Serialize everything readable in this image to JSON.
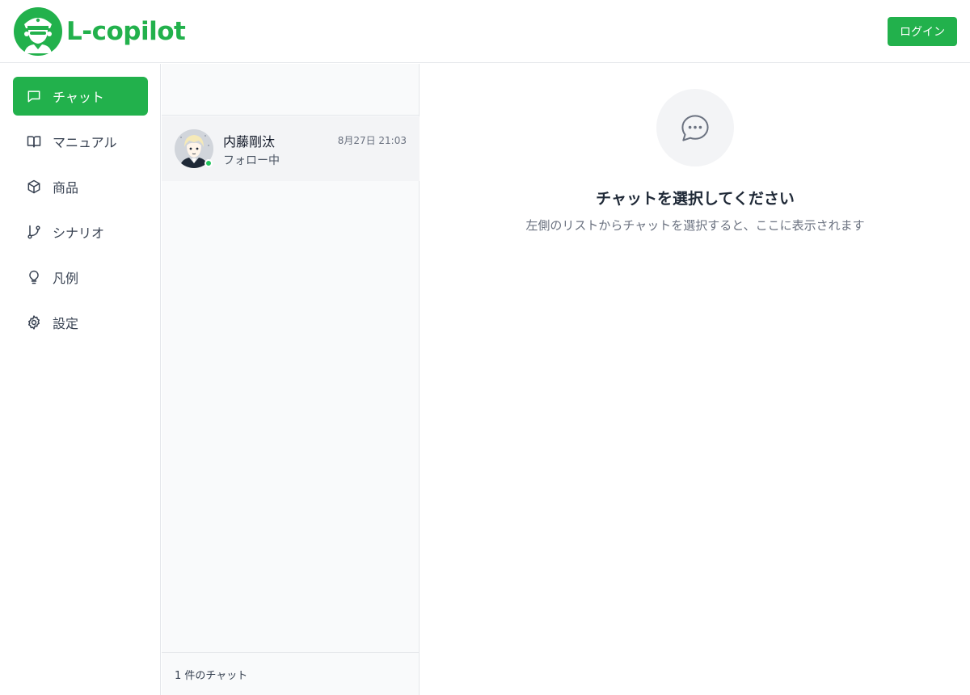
{
  "header": {
    "brand": "L-copilot",
    "login_label": "ログイン"
  },
  "colors": {
    "accent": "#22b14c",
    "online": "#22c55e"
  },
  "sidebar": {
    "items": [
      {
        "label": "チャット",
        "icon": "chat-bubble-icon",
        "active": true
      },
      {
        "label": "マニュアル",
        "icon": "book-icon",
        "active": false
      },
      {
        "label": "商品",
        "icon": "box-icon",
        "active": false
      },
      {
        "label": "シナリオ",
        "icon": "branch-icon",
        "active": false
      },
      {
        "label": "凡例",
        "icon": "lightbulb-icon",
        "active": false
      },
      {
        "label": "設定",
        "icon": "gear-icon",
        "active": false
      }
    ]
  },
  "chat_list": {
    "chats": [
      {
        "name": "内藤剛汰",
        "time": "8月27日 21:03",
        "status": "フォロー中",
        "online": true
      }
    ],
    "footer": "1 件のチャット"
  },
  "main": {
    "empty_title": "チャットを選択してください",
    "empty_subtitle": "左側のリストからチャットを選択すると、ここに表示されます"
  }
}
